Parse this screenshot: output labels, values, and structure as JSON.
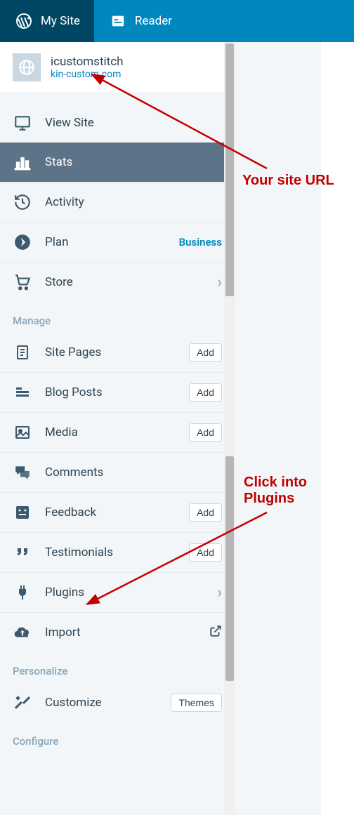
{
  "topbar": {
    "mysite": "My Site",
    "reader": "Reader"
  },
  "site": {
    "name": "icustomstitch",
    "url": "kin-custom.com"
  },
  "items": {
    "viewsite": "View Site",
    "stats": "Stats",
    "activity": "Activity",
    "plan": "Plan",
    "plan_badge": "Business",
    "store": "Store"
  },
  "manage": {
    "title": "Manage",
    "sitepages": "Site Pages",
    "blogposts": "Blog Posts",
    "media": "Media",
    "comments": "Comments",
    "feedback": "Feedback",
    "testimonials": "Testimonials",
    "plugins": "Plugins",
    "import": "Import"
  },
  "personalize": {
    "title": "Personalize",
    "customize": "Customize",
    "themes_btn": "Themes"
  },
  "configure": {
    "title": "Configure"
  },
  "buttons": {
    "add": "Add"
  },
  "annotations": {
    "url": "Your site URL",
    "plugins_l1": "Click into",
    "plugins_l2": "Plugins"
  }
}
